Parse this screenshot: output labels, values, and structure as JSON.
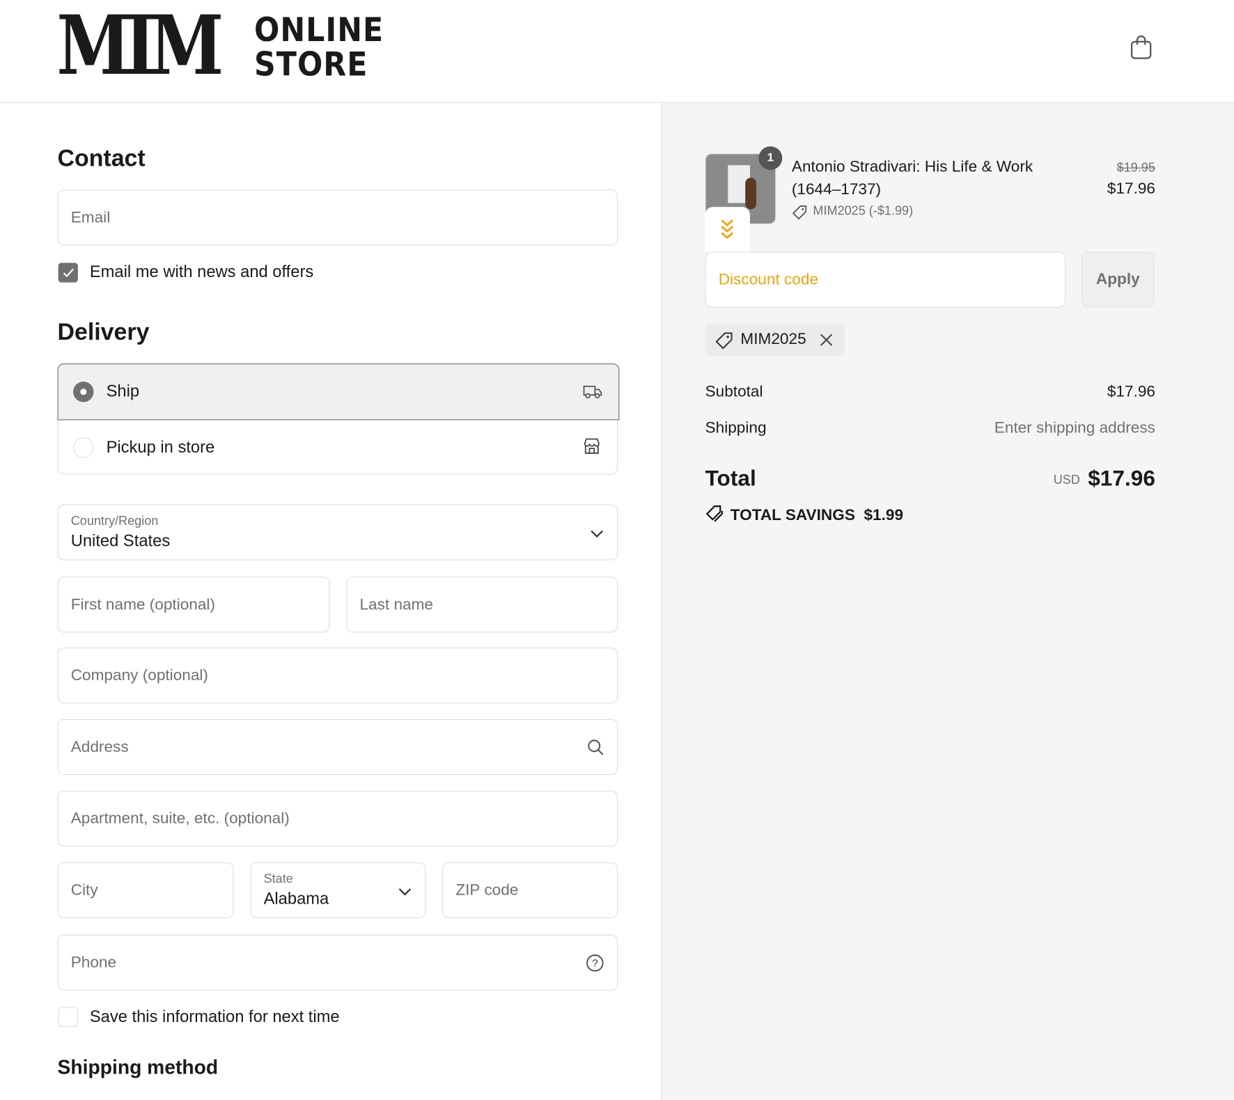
{
  "header": {
    "logo_mark": "MIM",
    "logo_line1": "ONLINE",
    "logo_line2": "STORE",
    "cart_icon": "shopping-bag-icon"
  },
  "contact": {
    "heading": "Contact",
    "email_placeholder": "Email",
    "newsletter_label": "Email me with news and offers",
    "newsletter_checked": true
  },
  "delivery": {
    "heading": "Delivery",
    "options": [
      {
        "label": "Ship",
        "selected": true,
        "icon": "truck-icon"
      },
      {
        "label": "Pickup in store",
        "selected": false,
        "icon": "store-icon"
      }
    ]
  },
  "address": {
    "country_label": "Country/Region",
    "country_value": "United States",
    "first_name_placeholder": "First name (optional)",
    "last_name_placeholder": "Last name",
    "company_placeholder": "Company (optional)",
    "address_placeholder": "Address",
    "apartment_placeholder": "Apartment, suite, etc. (optional)",
    "city_placeholder": "City",
    "state_label": "State",
    "state_value": "Alabama",
    "zip_placeholder": "ZIP code",
    "phone_placeholder": "Phone",
    "save_label": "Save this information for next time",
    "save_checked": false
  },
  "shipping_method": {
    "heading": "Shipping method"
  },
  "summary": {
    "item": {
      "quantity": "1",
      "title_line1": "Antonio Stradivari: His Life & Work",
      "title_line2": "(1644–1737)",
      "discount": "MIM2025 (-$1.99)",
      "original_price": "$19.95",
      "price": "$17.96"
    },
    "discount_placeholder": "Discount code",
    "apply_label": "Apply",
    "applied_code": "MIM2025",
    "subtotal_label": "Subtotal",
    "subtotal_value": "$17.96",
    "shipping_label": "Shipping",
    "shipping_value": "Enter shipping address",
    "total_label": "Total",
    "currency": "USD",
    "total_value": "$17.96",
    "savings_label": "TOTAL SAVINGS",
    "savings_value": "$1.99"
  },
  "colors": {
    "accent": "#f0a30a",
    "right_bg": "#f5f5f5"
  }
}
